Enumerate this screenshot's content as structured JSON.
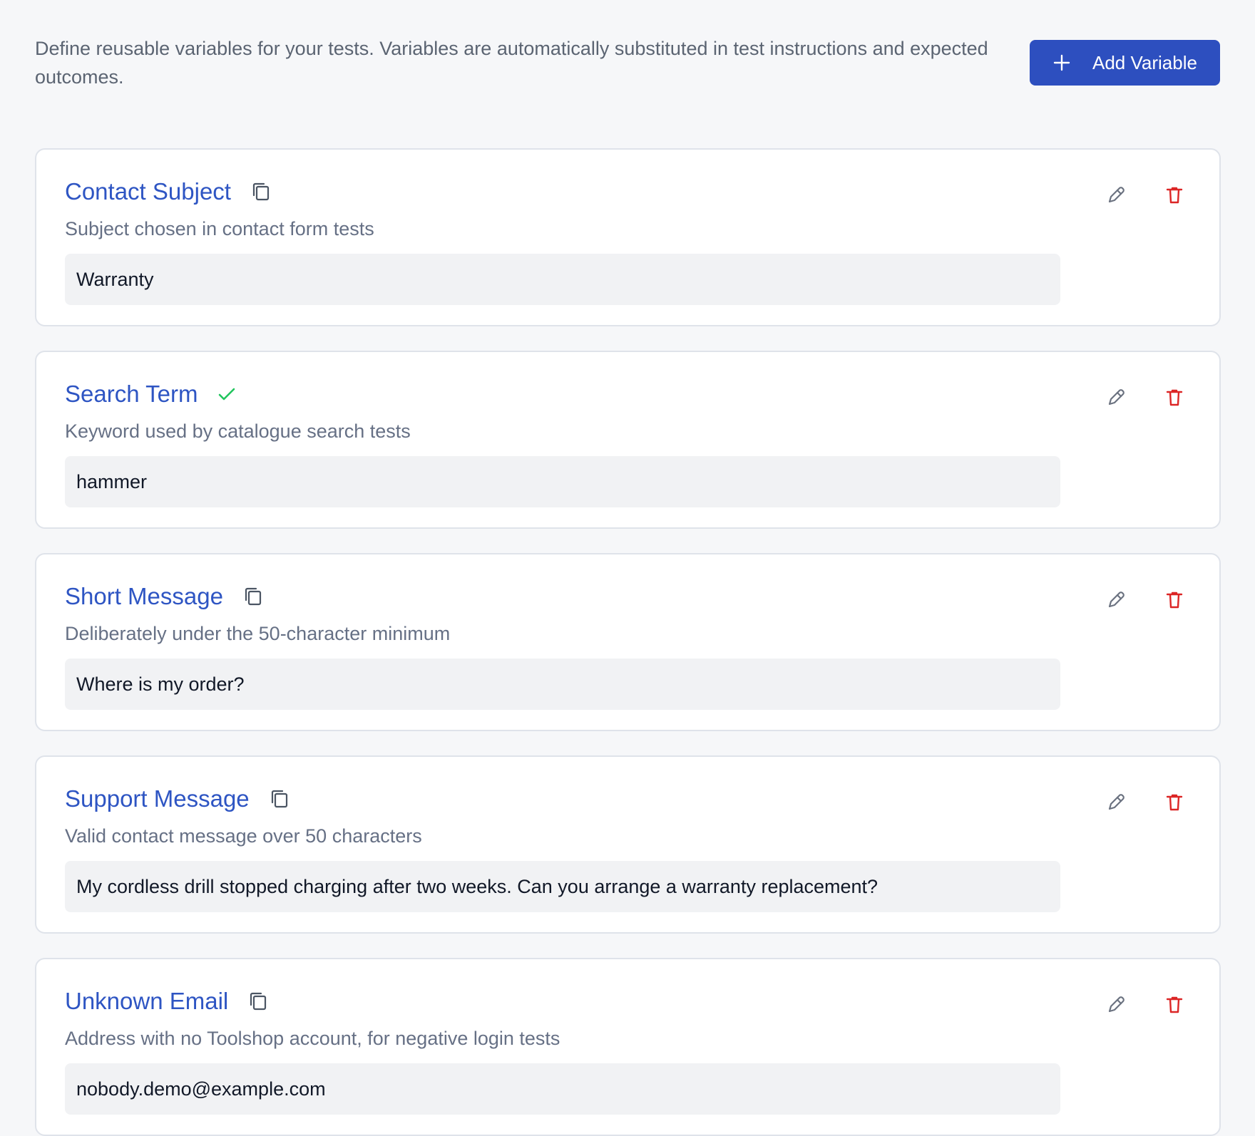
{
  "header": {
    "description": "Define reusable variables for your tests. Variables are automatically substituted in test instructions and expected outcomes.",
    "add_button_label": "Add Variable"
  },
  "variables": [
    {
      "name": "Contact Subject",
      "description": "Subject chosen in contact form tests",
      "value": "Warranty",
      "title_action_icon": "copy-icon"
    },
    {
      "name": "Search Term",
      "description": "Keyword used by catalogue search tests",
      "value": "hammer",
      "title_action_icon": "check-icon"
    },
    {
      "name": "Short Message",
      "description": "Deliberately under the 50-character minimum",
      "value": "Where is my order?",
      "title_action_icon": "copy-icon"
    },
    {
      "name": "Support Message",
      "description": "Valid contact message over 50 characters",
      "value": "My cordless drill stopped charging after two weeks. Can you arrange a warranty replacement?",
      "title_action_icon": "copy-icon"
    },
    {
      "name": "Unknown Email",
      "description": "Address with no Toolshop account, for negative login tests",
      "value": "nobody.demo@example.com",
      "title_action_icon": "copy-icon"
    }
  ],
  "icons": {
    "add": "plus-icon",
    "edit": "pencil-icon",
    "delete": "trash-icon",
    "copy": "copy-icon",
    "copied": "check-icon"
  },
  "colors": {
    "background": "#f6f7f9",
    "accent": "#2d4fbf",
    "title": "#2e55c3",
    "success": "#22c55e",
    "danger": "#dc2626",
    "card_border": "#dfe3ea",
    "value_bg": "#f1f2f4"
  }
}
